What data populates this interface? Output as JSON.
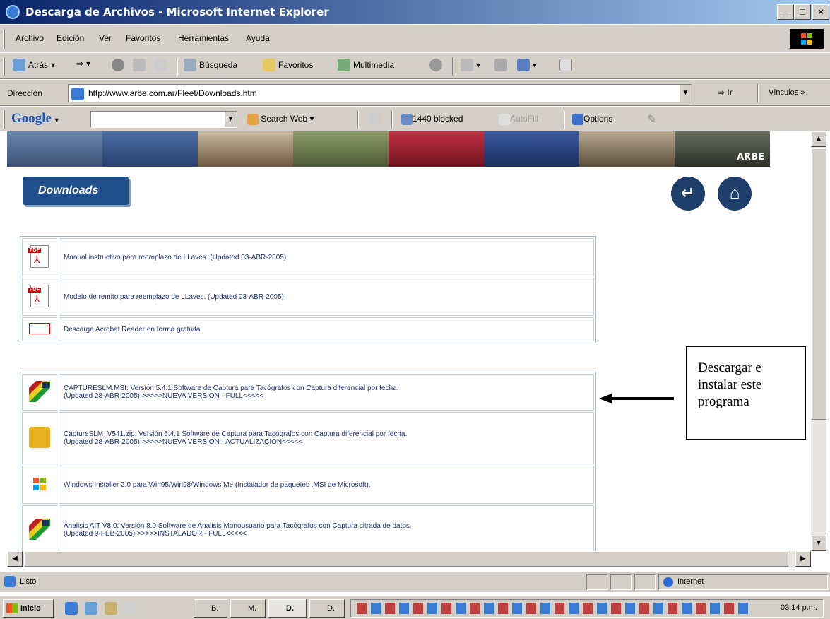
{
  "window": {
    "title": "Descarga de Archivos - Microsoft Internet Explorer",
    "minimize": "_",
    "maximize": "□",
    "close": "×"
  },
  "menu": {
    "items": [
      "Archivo",
      "Edición",
      "Ver",
      "Favoritos",
      "Herramientas",
      "Ayuda"
    ]
  },
  "toolbar": {
    "back_label": "Atrás",
    "search_label": "Búsqueda",
    "favorites_label": "Favoritos",
    "multimedia_label": "Multimedia"
  },
  "address": {
    "label": "Dirección",
    "url": "http://www.arbe.com.ar/Fleet/Downloads.htm",
    "go_label": "Ir",
    "links_label": "Vínculos"
  },
  "google_bar": {
    "logo": "Google",
    "search_web_label": "Search Web",
    "blocked_label": "1440 blocked",
    "autofill_label": "AutoFill",
    "options_label": "Options"
  },
  "page": {
    "brand_logo": "ARBE",
    "downloads_title": "Downloads",
    "group1": [
      {
        "icon": "pdf-icon",
        "text": "Manual instructivo para reemplazo de LLaves. (Updated 03-ABR-2005)"
      },
      {
        "icon": "pdf-icon",
        "text": "Modelo de remito para reemplazo de LLaves. (Updated 03-ABR-2005)"
      },
      {
        "icon": "acrobat-reader-icon",
        "text": "Descarga Acrobat Reader en forma gratuita."
      }
    ],
    "group2": [
      {
        "icon": "arbe-app-icon",
        "line1": "CAPTURESLM.MSI: Versión 5.4.1 Software de Captura para Tacógrafos con Captura diferencial por fecha.",
        "line2": "(Updated 28-ABR-2005) >>>>>NUEVA VERSION - FULL<<<<<"
      },
      {
        "icon": "computer-icon",
        "line1": "CaptureSLM_V541.zip: Versión 5.4.1 Software de Captura para Tacógrafos con Captura diferencial por fecha.",
        "line2": "(Updated 28-ABR-2005) >>>>>NUEVA VERSION - ACTUALIZACION<<<<<"
      },
      {
        "icon": "windows-installer-icon",
        "line1": "Windows Installer 2.0 para Win95/Win98/Windows Me (Instalador de paquetes .MSI de Microsoft).",
        "line2": ""
      },
      {
        "icon": "arbe-app-icon",
        "line1": "Analisis AIT V8.0: Versión 8.0 Software de Analisis Monousuario para Tacógrafos con Captura citrada de datos.",
        "line2": "(Updated 9-FEB-2005) >>>>>INSTALADOR - FULL<<<<<"
      }
    ]
  },
  "annotation": {
    "text": "Descargar e instalar este programa"
  },
  "status_bar": {
    "status": "Listo",
    "zone": "Internet"
  },
  "taskbar": {
    "start_label": "Inicio",
    "buttons": [
      "B.",
      "M.",
      "D.",
      "D."
    ],
    "clock": "03:14 p.m."
  },
  "colors": {
    "title_bar": "#0a246a",
    "link_blue": "#1f3170",
    "downloads_button": "#1f4e8a",
    "chrome": "#d4d0c8"
  }
}
